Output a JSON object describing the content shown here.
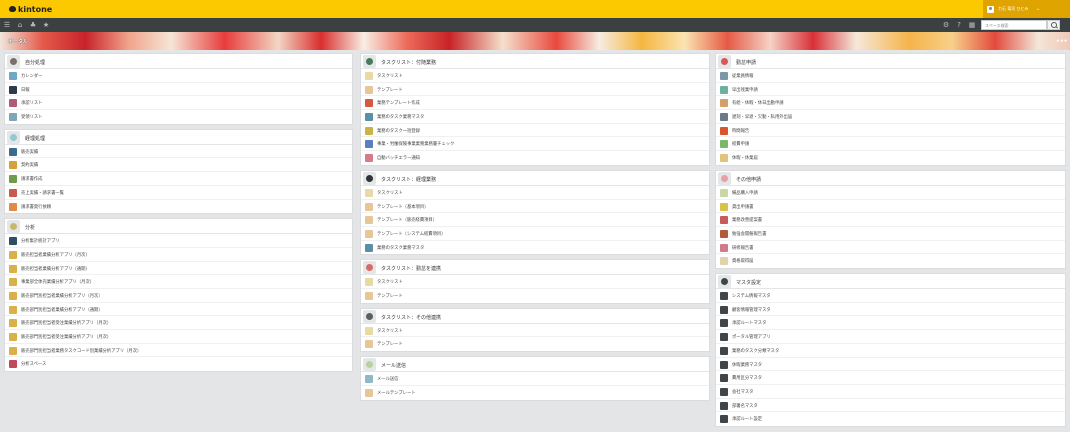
{
  "header": {
    "logo_text": "kintone",
    "user_name": "力石 竜司 ひとみ"
  },
  "navbar": {
    "search_placeholder": "スペース検索"
  },
  "banner": {
    "title": "ポータル",
    "menu_label": "•••"
  },
  "columns": [
    [
      {
        "title": "自分処理",
        "icon": "clock-icon",
        "color": "#7a6f6a",
        "items": [
          {
            "label": "カレンダー",
            "icon": "calendar-app-icon",
            "color": "#6fa8c7"
          },
          {
            "label": "日報",
            "icon": "report-app-icon",
            "color": "#2d3b4a"
          },
          {
            "label": "承認リスト",
            "icon": "approval-app-icon",
            "color": "#b05a7a"
          },
          {
            "label": "受領リスト",
            "icon": "receipt-app-icon",
            "color": "#7da6b8"
          }
        ]
      },
      {
        "title": "経理処理",
        "icon": "document-icon",
        "color": "#9ac6d1",
        "items": [
          {
            "label": "販売実績",
            "icon": "sales-app-icon",
            "color": "#3a6b8a"
          },
          {
            "label": "契約実績",
            "icon": "contract-app-icon",
            "color": "#d5a13b"
          },
          {
            "label": "請求書作成",
            "icon": "invoice-app-icon",
            "color": "#6d9c4b"
          },
          {
            "label": "売上実績・請求書一覧",
            "icon": "sales-list-app-icon",
            "color": "#c75b4e"
          },
          {
            "label": "請求書発行依頼",
            "icon": "invoice-request-app-icon",
            "color": "#e08a4a"
          }
        ]
      },
      {
        "title": "分析",
        "icon": "chart-icon",
        "color": "#c7b96a",
        "items": [
          {
            "label": "分析集計統計アプリ",
            "icon": "analytics-app-icon",
            "color": "#2f4d63"
          },
          {
            "label": "販売担当者業績分析アプリ（月次）",
            "icon": "bar-chart-app-icon",
            "color": "#d9b04a"
          },
          {
            "label": "販売担当者業績分析アプリ（通期）",
            "icon": "bar-chart-app-icon",
            "color": "#d9b04a"
          },
          {
            "label": "事業部全体売業績分析アプリ（月次）",
            "icon": "bar-chart-app-icon",
            "color": "#d9b04a"
          },
          {
            "label": "販売部門別担当者業績分析アプリ（月次）",
            "icon": "bar-chart-app-icon",
            "color": "#d9b04a"
          },
          {
            "label": "販売部門別担当者業績分析アプリ（通期）",
            "icon": "bar-chart-app-icon",
            "color": "#d9b04a"
          },
          {
            "label": "販売部門別担当者受注業績分析アプリ（月次）",
            "icon": "bar-chart-app-icon",
            "color": "#d9b04a"
          },
          {
            "label": "販売部門別担当者受注業績分析アプリ（月次）",
            "icon": "bar-chart-app-icon",
            "color": "#d9b04a"
          },
          {
            "label": "販売部門別担当者業務タスクコード別業績分析アプリ（月次）",
            "icon": "bar-chart-app-icon",
            "color": "#d9b04a"
          },
          {
            "label": "分析スペース",
            "icon": "space-icon",
            "color": "#c14a5a"
          }
        ]
      }
    ],
    [
      {
        "title": "タスクリスト：付随業務",
        "icon": "monitor-icon",
        "color": "#4b7a5a",
        "items": [
          {
            "label": "タスクリスト",
            "icon": "task-list-app-icon",
            "color": "#e8d9a6"
          },
          {
            "label": "テンプレート",
            "icon": "template-app-icon",
            "color": "#e7c79a"
          },
          {
            "label": "業務テンプレート作成",
            "icon": "template-create-app-icon",
            "color": "#d15b3e"
          },
          {
            "label": "業務のタスク業務マスタ",
            "icon": "task-master-app-icon",
            "color": "#5b8fa8"
          },
          {
            "label": "業務のタスク一括登録",
            "icon": "bulk-register-app-icon",
            "color": "#c9b44a"
          },
          {
            "label": "事業・労働保険事業業務業務量チェック",
            "icon": "check-app-icon",
            "color": "#5a7fc1"
          },
          {
            "label": "自動バッチエラー通知",
            "icon": "error-notice-app-icon",
            "color": "#d87a8a"
          }
        ]
      },
      {
        "title": "タスクリスト：経理業務",
        "icon": "folder-icon",
        "color": "#2e3438",
        "items": [
          {
            "label": "タスクリスト",
            "icon": "task-list-app-icon",
            "color": "#e8d9a6"
          },
          {
            "label": "テンプレート（基本項目）",
            "icon": "template-app-icon",
            "color": "#e7c79a"
          },
          {
            "label": "テンプレート（販売経費項目）",
            "icon": "template-app-icon",
            "color": "#e7c79a"
          },
          {
            "label": "テンプレート（システム経費項目）",
            "icon": "template-app-icon",
            "color": "#e7c79a"
          },
          {
            "label": "業務のタスク業務マスタ",
            "icon": "task-master-app-icon",
            "color": "#5b8fa8"
          }
        ]
      },
      {
        "title": "タスクリスト：勤怠を連携",
        "icon": "pen-icon",
        "color": "#d96a6a",
        "items": [
          {
            "label": "タスクリスト",
            "icon": "task-list-app-icon",
            "color": "#e8d9a6"
          },
          {
            "label": "テンプレート",
            "icon": "template-app-icon",
            "color": "#e7c79a"
          }
        ]
      },
      {
        "title": "タスクリスト：その他連携",
        "icon": "people-icon",
        "color": "#5a5e60",
        "items": [
          {
            "label": "タスクリスト",
            "icon": "task-list-app-icon",
            "color": "#e8d9a6"
          },
          {
            "label": "テンプレート",
            "icon": "template-app-icon",
            "color": "#e7c79a"
          }
        ]
      },
      {
        "title": "メール送信",
        "icon": "mail-icon",
        "color": "#b7d3a0",
        "items": [
          {
            "label": "メール送信",
            "icon": "mail-send-app-icon",
            "color": "#8fb8c9"
          },
          {
            "label": "メールテンプレート",
            "icon": "mail-template-app-icon",
            "color": "#e7c79a"
          }
        ]
      }
    ],
    [
      {
        "title": "勤怠申請",
        "icon": "shield-icon",
        "color": "#d9545c",
        "items": [
          {
            "label": "従業員情報",
            "icon": "employee-app-icon",
            "color": "#7d96a8"
          },
          {
            "label": "早出残業申請",
            "icon": "overtime-app-icon",
            "color": "#6bb0a0"
          },
          {
            "label": "有給・休暇・休日出勤申請",
            "icon": "leave-app-icon",
            "color": "#d3a06a"
          },
          {
            "label": "遅刻・早退・欠勤・私用外出届",
            "icon": "late-app-icon",
            "color": "#6a7a8a"
          },
          {
            "label": "時間報告",
            "icon": "time-report-app-icon",
            "color": "#d8562e"
          },
          {
            "label": "経費申請",
            "icon": "expense-app-icon",
            "color": "#7cb86a"
          },
          {
            "label": "休暇・休業届",
            "icon": "absence-app-icon",
            "color": "#e2c37a"
          }
        ]
      },
      {
        "title": "その他申請",
        "icon": "flag-icon",
        "color": "#e7a0a6",
        "items": [
          {
            "label": "備品購入申請",
            "icon": "purchase-app-icon",
            "color": "#c7d8a6"
          },
          {
            "label": "貸出申請書",
            "icon": "lend-app-icon",
            "color": "#d9c24a"
          },
          {
            "label": "業務改善提案書",
            "icon": "proposal-app-icon",
            "color": "#c85a5a"
          },
          {
            "label": "勉強会開催報告書",
            "icon": "study-app-icon",
            "color": "#b35a3a"
          },
          {
            "label": "研修報告書",
            "icon": "training-app-icon",
            "color": "#d17a8a"
          },
          {
            "label": "資格取得届",
            "icon": "license-app-icon",
            "color": "#e0d4a8"
          }
        ]
      },
      {
        "title": "マスタ設定",
        "icon": "settings-icon",
        "color": "#3f4548",
        "items": [
          {
            "label": "システム情報マスタ",
            "icon": "master-app-icon",
            "color": "#3f4548"
          },
          {
            "label": "顧客情報管理マスタ",
            "icon": "master-app-icon",
            "color": "#3f4548"
          },
          {
            "label": "承認ルートマスタ",
            "icon": "master-app-icon",
            "color": "#3f4548"
          },
          {
            "label": "ポータル管理アプリ",
            "icon": "master-app-icon",
            "color": "#3f4548"
          },
          {
            "label": "業務のタスク分類マスタ",
            "icon": "master-app-icon",
            "color": "#3f4548"
          },
          {
            "label": "休暇業務マスタ",
            "icon": "master-app-icon",
            "color": "#3f4548"
          },
          {
            "label": "費用区分マスタ",
            "icon": "master-app-icon",
            "color": "#3f4548"
          },
          {
            "label": "会社マスタ",
            "icon": "master-app-icon",
            "color": "#3f4548"
          },
          {
            "label": "部署名マスタ",
            "icon": "master-app-icon",
            "color": "#3f4548"
          },
          {
            "label": "承認ルート設定",
            "icon": "master-app-icon",
            "color": "#3f4548"
          }
        ]
      }
    ]
  ]
}
